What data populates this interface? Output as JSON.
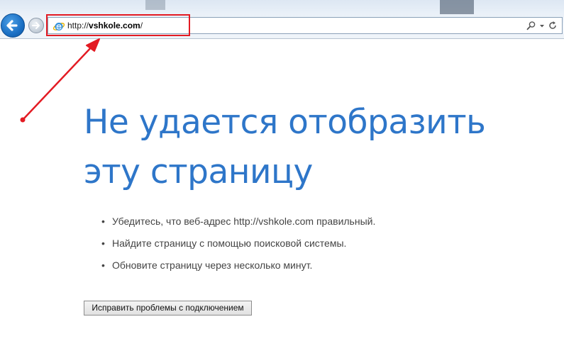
{
  "toolbar": {
    "back_icon": "back-arrow-icon",
    "forward_icon": "forward-arrow-icon",
    "address": {
      "site_icon": "ie-icon",
      "prefix": "http://",
      "host": "vshkole.com",
      "suffix": "/"
    },
    "search_icon": "search-icon",
    "dropdown_icon": "chevron-down-icon",
    "refresh_icon": "refresh-icon"
  },
  "annotation": {
    "color": "#e31b23"
  },
  "error": {
    "title": "Не удается отобразить эту страницу",
    "title_color": "#2e76c9",
    "suggestions": [
      "Убедитесь, что веб-адрес http://vshkole.com правильный.",
      "Найдите страницу с помощью поисковой системы.",
      "Обновите страницу через несколько минут."
    ],
    "fix_button_label": "Исправить проблемы с подключением"
  }
}
